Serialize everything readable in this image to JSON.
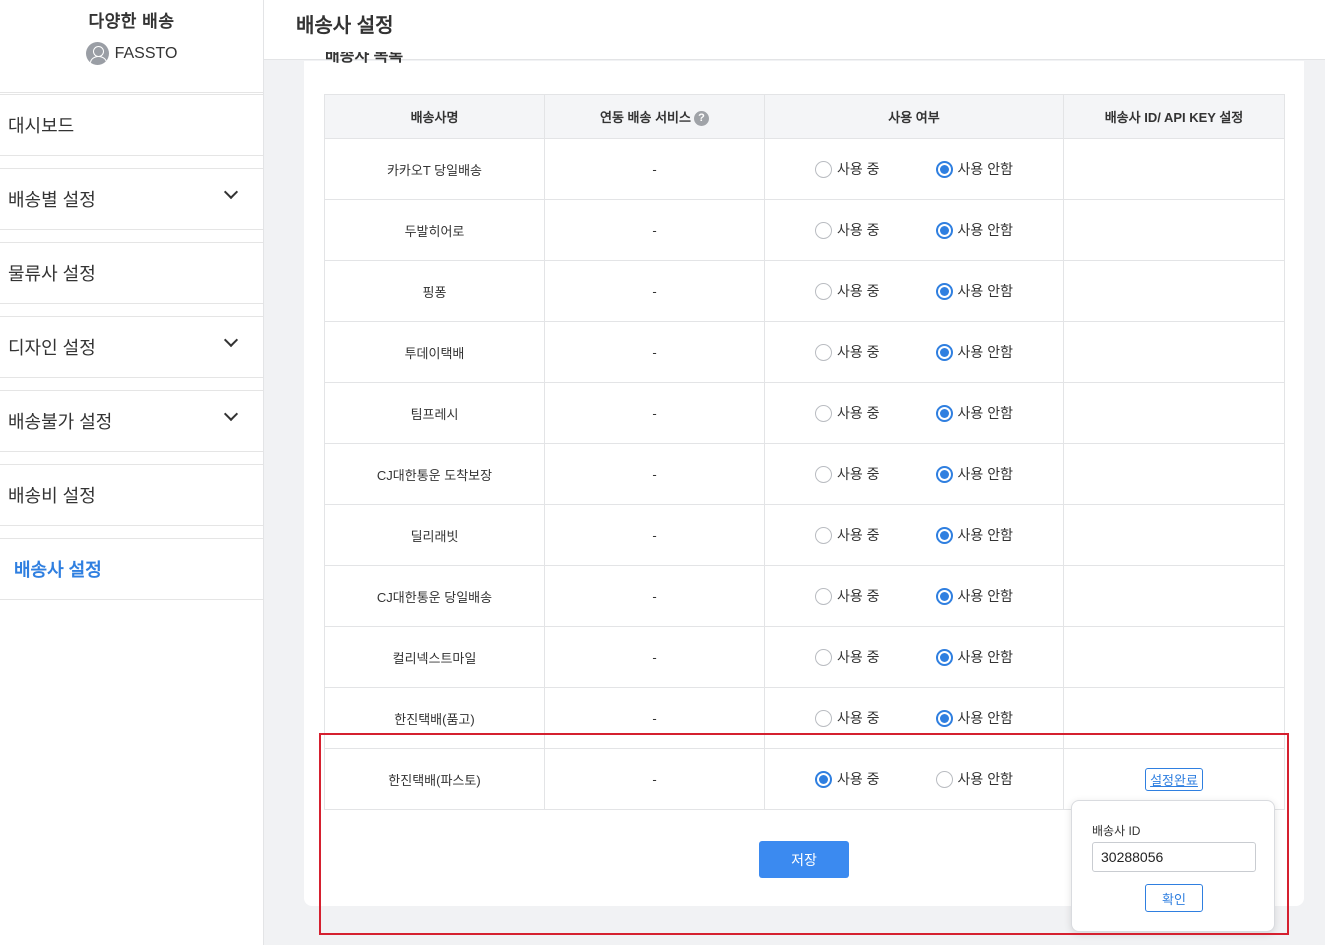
{
  "sidebar": {
    "brand_title": "다양한 배송",
    "user_name": "FASSTO",
    "items": [
      {
        "label": "대시보드",
        "expandable": false
      },
      {
        "label": "배송별 설정",
        "expandable": true
      },
      {
        "label": "물류사 설정",
        "expandable": false
      },
      {
        "label": "디자인 설정",
        "expandable": true
      },
      {
        "label": "배송불가 설정",
        "expandable": true
      },
      {
        "label": "배송비 설정",
        "expandable": false
      },
      {
        "label": "배송사 설정",
        "expandable": false,
        "active": true
      }
    ]
  },
  "header": {
    "title": "배송사 설정"
  },
  "card": {
    "title": "배송사 목록"
  },
  "table": {
    "headers": [
      "배송사명",
      "연동 배송 서비스",
      "사용 여부",
      "배송사 ID/ API KEY 설정"
    ],
    "option_on": "사용 중",
    "option_off": "사용 안함",
    "rows": [
      {
        "name": "카카오T 당일배송",
        "service": "-",
        "in_use": false,
        "setting": ""
      },
      {
        "name": "두발히어로",
        "service": "-",
        "in_use": false,
        "setting": ""
      },
      {
        "name": "핑퐁",
        "service": "-",
        "in_use": false,
        "setting": ""
      },
      {
        "name": "투데이택배",
        "service": "-",
        "in_use": false,
        "setting": ""
      },
      {
        "name": "팀프레시",
        "service": "-",
        "in_use": false,
        "setting": ""
      },
      {
        "name": "CJ대한통운 도착보장",
        "service": "-",
        "in_use": false,
        "setting": ""
      },
      {
        "name": "딜리래빗",
        "service": "-",
        "in_use": false,
        "setting": ""
      },
      {
        "name": "CJ대한통운 당일배송",
        "service": "-",
        "in_use": false,
        "setting": ""
      },
      {
        "name": "컬리넥스트마일",
        "service": "-",
        "in_use": false,
        "setting": ""
      },
      {
        "name": "한진택배(품고)",
        "service": "-",
        "in_use": false,
        "setting": ""
      },
      {
        "name": "한진택배(파스토)",
        "service": "-",
        "in_use": true,
        "setting": "설정완료"
      }
    ]
  },
  "save_label": "저장",
  "popover": {
    "label": "배송사 ID",
    "value": "30288056",
    "confirm_label": "확인"
  },
  "colors": {
    "accent": "#2f7fe0",
    "save_button": "#3b8af0",
    "highlight": "#d5202f"
  }
}
